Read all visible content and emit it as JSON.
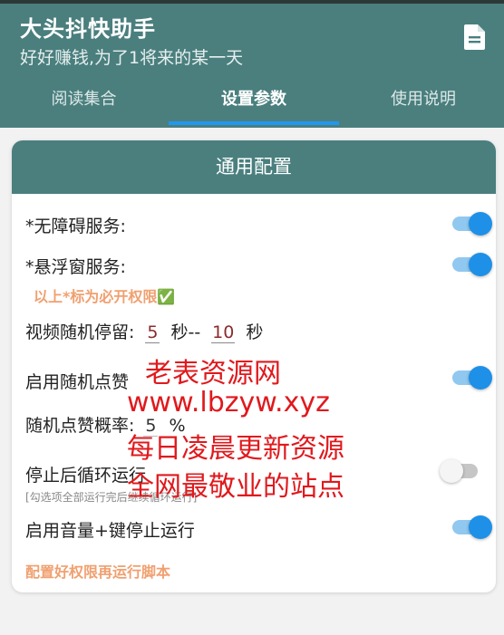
{
  "app": {
    "title": "大头抖快助手",
    "subtitle": "好好赚钱,为了1将来的某一天",
    "doc_icon": "document-icon"
  },
  "tabs": [
    {
      "label": "阅读集合",
      "active": false
    },
    {
      "label": "设置参数",
      "active": true
    },
    {
      "label": "使用说明",
      "active": false
    }
  ],
  "card": {
    "title": "通用配置",
    "accessibility": {
      "label": "*无障碍服务:",
      "enabled": true
    },
    "floating_window": {
      "label": "*悬浮窗服务:",
      "enabled": true
    },
    "required_hint": "以上*标为必开权限✅",
    "video_stay": {
      "label": "视频随机停留:",
      "min": "5",
      "sep": "秒--",
      "max": "10",
      "unit": "秒"
    },
    "random_like": {
      "label": "启用随机点赞",
      "enabled": true
    },
    "like_rate": {
      "label": "随机点赞概率:",
      "value": "5",
      "unit": "%"
    },
    "stop_loop": {
      "label": "停止后循环运行",
      "enabled": false,
      "hint": "[勾选项全部运行完后继续循环运行]"
    },
    "volume_stop": {
      "label": "启用音量+键停止运行",
      "enabled": true
    },
    "bottom_hint": "配置好权限再运行脚本"
  },
  "watermark": {
    "line1": "老表资源网",
    "line2": "www.lbzyw.xyz",
    "line3": "每日凌晨更新资源",
    "line4": "全网最敬业的站点"
  },
  "colors": {
    "primary": "#4a7f7e",
    "accent": "#1e90e8",
    "hint": "#f0a070",
    "watermark": "#e0191d"
  }
}
